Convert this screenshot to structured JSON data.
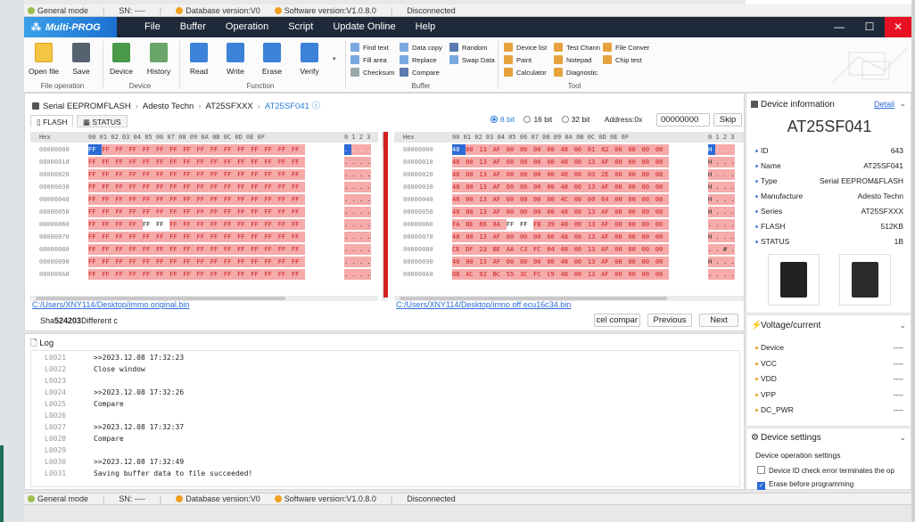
{
  "statusbar": {
    "mode": "General mode",
    "sn": "SN:  ----",
    "db": "Database version:V0",
    "sw": "Software version:V1.0.8.0",
    "conn": "Disconnected"
  },
  "titlebar": {
    "app": "Multi-PROG",
    "menu": [
      "File",
      "Buffer",
      "Operation",
      "Script",
      "Update Online",
      "Help"
    ],
    "min": "—",
    "max": "☐",
    "close": "✕"
  },
  "ribbon": {
    "file_buttons": [
      "Open file",
      "Save"
    ],
    "device_buttons": [
      "Device",
      "History"
    ],
    "function_buttons": [
      "Read",
      "Write",
      "Erase",
      "Verify"
    ],
    "buffer_items": [
      "Find text",
      "Fill area",
      "Checksum",
      "Data copy",
      "Replace",
      "Compare",
      "Random",
      "Swap Data"
    ],
    "tool_items": [
      "Device list",
      "Paint",
      "Calculator",
      "Test Chann",
      "Notepad",
      "Diagnostic",
      "File Conver",
      "Chip test"
    ],
    "groups": [
      "File operation",
      "Device",
      "Function",
      "Buffer",
      "Tool"
    ]
  },
  "breadcrumb": [
    "Serial EEPROMFLASH",
    "Adesto Techn",
    "AT25SFXXX",
    "AT25SF041"
  ],
  "tabs": [
    "FLASH",
    "STATUS"
  ],
  "bits": {
    "opt1": "8 bit",
    "opt2": "16 bit",
    "opt3": "32 bit",
    "address_label": "Address:0x",
    "address_value": "00000000",
    "skip": "Skip"
  },
  "hex": {
    "header_label": "Hex",
    "col_header": "00 01 02 03 04 05 06 07 08 09 0A 0B 0C 0D 0E 0F",
    "ascii_header": "0 1 2 3",
    "addresses": [
      "00000000",
      "00000010",
      "00000020",
      "00000030",
      "00000040",
      "00000050",
      "00000060",
      "00000070",
      "00000080",
      "00000090",
      "000000A0"
    ],
    "left_rows": [
      "FF FF FF FF FF FF FF FF FF FF FF FF FF FF FF FF",
      "FF FF FF FF FF FF FF FF FF FF FF FF FF FF FF FF",
      "FF FF FF FF FF FF FF FF FF FF FF FF FF FF FF FF",
      "FF FF FF FF FF FF FF FF FF FF FF FF FF FF FF FF",
      "FF FF FF FF FF FF FF FF FF FF FF FF FF FF FF FF",
      "FF FF FF FF FF FF FF FF FF FF FF FF FF FF FF FF",
      "FF FF FF FF FF FF FF FF FF FF FF FF FF FF FF FF",
      "FF FF FF FF FF FF FF FF FF FF FF FF FF FF FF FF",
      "FF FF FF FF FF FF FF FF FF FF FF FF FF FF FF FF",
      "FF FF FF FF FF FF FF FF FF FF FF FF FF FF FF FF",
      "FF FF FF FF FF FF FF FF FF FF FF FF FF FF FF FF"
    ],
    "right_rows": [
      "48 00 13 AF 00 00 00 00 48 00 01 82 00 00 00 00",
      "48 00 13 AF 00 00 00 00 48 00 13 AF 00 00 00 00",
      "48 00 13 AF 00 00 00 00 48 00 03 2E 00 00 00 00",
      "48 00 13 AF 00 00 00 00 48 00 13 AF 00 00 00 00",
      "48 00 13 AF 00 00 00 00 4C 00 00 64 00 00 00 00",
      "48 00 13 AF 00 00 00 00 48 00 13 AF 00 00 00 00",
      "FA BE 86 8A FF FF FB 39 48 00 13 AF 00 00 00 00",
      "48 00 13 AF 00 00 00 00 48 00 13 AF 00 00 00 00",
      "CE DF 23 BE AA C3 FC 04 48 00 13 AF 00 00 00 00",
      "48 00 13 AF 00 00 00 00 48 00 13 AF 00 00 00 00",
      "DB AC 92 BC 55 3C FC C9 48 00 13 AF 00 00 00 00"
    ],
    "left_ascii": [
      ". . . .",
      ". . . .",
      ". . . .",
      ". . . .",
      ". . . .",
      ". . . .",
      ". . . .",
      ". . . .",
      ". . . .",
      ". . . .",
      ". . . ."
    ],
    "right_ascii": [
      "H . . .",
      "H . . .",
      "H . . .",
      "H . . .",
      "H . . .",
      "H . . .",
      ". . . .",
      "H . . .",
      ". . # .",
      "H . . .",
      ". . . ."
    ]
  },
  "paths": {
    "left": "C:/Users/XNY114/Desktop/immo original.bin",
    "right": "C:/Users/XNY114/Desktop/imno off ecu16c34.bin"
  },
  "compare": {
    "sha_prefix": "Sha",
    "sha_value": "524203",
    "diff": "Different c",
    "cancel": "cel compar",
    "previous": "Previous",
    "next": "Next"
  },
  "log": {
    "title": "Log",
    "lines": [
      {
        "n": "L0021",
        "t": ">>2023.12.08 17:32:23"
      },
      {
        "n": "L0022",
        "t": "Close window"
      },
      {
        "n": "L0023",
        "t": ""
      },
      {
        "n": "L0024",
        "t": ">>2023.12.08 17:32:26"
      },
      {
        "n": "L0025",
        "t": "Compare"
      },
      {
        "n": "L0026",
        "t": ""
      },
      {
        "n": "L0027",
        "t": ">>2023.12.08 17:32:37"
      },
      {
        "n": "L0028",
        "t": "Compare"
      },
      {
        "n": "L0029",
        "t": ""
      },
      {
        "n": "L0030",
        "t": ">>2023.12.08 17:32:49"
      },
      {
        "n": "L0031",
        "t": "Saving buffer data to file succeeded!"
      }
    ]
  },
  "device_info": {
    "title": "Device information",
    "detail": "Detail",
    "name": "AT25SF041",
    "fields": [
      {
        "k": "ID",
        "v": "643"
      },
      {
        "k": "Name",
        "v": "AT25SF041"
      },
      {
        "k": "Type",
        "v": "Serial EEPROM&FLASH"
      },
      {
        "k": "Manufacture",
        "v": "Adesto Techn"
      },
      {
        "k": "Series",
        "v": "AT25SFXXX"
      },
      {
        "k": "FLASH",
        "v": "512KB"
      },
      {
        "k": "STATUS",
        "v": "1B"
      }
    ]
  },
  "voltage": {
    "title": "Voltage/current",
    "fields": [
      {
        "k": "Device",
        "v": "----"
      },
      {
        "k": "VCC",
        "v": "----"
      },
      {
        "k": "VDD",
        "v": "----"
      },
      {
        "k": "VPP",
        "v": "----"
      },
      {
        "k": "DC_PWR",
        "v": "----"
      }
    ]
  },
  "device_settings": {
    "title": "Device settings",
    "subtitle": "Device operation settings",
    "opt1": "Device ID check error terminates the op",
    "opt2": "Erase before programming",
    "top_partial": "Erase before programming"
  },
  "colors": {
    "accent": "#2b6bd8",
    "diff_bg": "#f6aaaa",
    "diff_text": "#cc1e1e",
    "titlebar": "#1e2a3a",
    "close": "#e81123"
  }
}
